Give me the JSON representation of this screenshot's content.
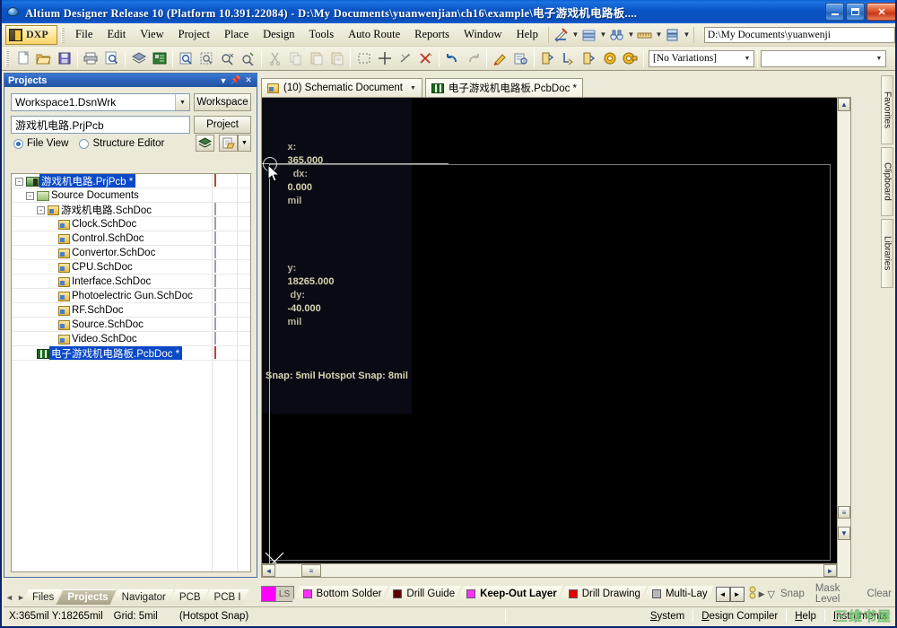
{
  "window": {
    "title": "Altium Designer Release 10 (Platform 10.391.22084) - D:\\My Documents\\yuanwenjian\\ch16\\example\\电子游戏机电路板....",
    "app_icon": "altium-sphere-icon",
    "minimize": "minimize-icon",
    "maximize": "maximize-icon",
    "close": "close-icon"
  },
  "menubar": {
    "dxp_label": "DXP",
    "items": [
      "File",
      "Edit",
      "View",
      "Project",
      "Place",
      "Design",
      "Tools",
      "Auto Route",
      "Reports",
      "Window",
      "Help"
    ],
    "tools": [
      "ruler-pencil-icon",
      "layers-stack-icon",
      "binoculars-icon",
      "ruler-bar-icon",
      "stack-sheets-icon"
    ],
    "path_value": "D:\\My Documents\\yuanwenji"
  },
  "toolbar": {
    "icons": [
      "new-document-icon",
      "open-folder-icon",
      "save-icon",
      "print-icon",
      "print-preview-icon",
      "board-layers-icon",
      "pcb-board-icon",
      "zoom-document-icon",
      "zoom-area-icon",
      "zoom-out-icon",
      "zoom-selected-icon",
      "cut-icon",
      "copy-icon",
      "paste-icon",
      "paste-special-icon",
      "select-area-icon",
      "move-icon",
      "deselect-icon",
      "clear-selection-icon",
      "undo-icon",
      "redo-icon",
      "highlight-icon",
      "cross-probe-icon",
      "place-component-icon",
      "place-net-icon",
      "place-polygon-icon",
      "place-via-icon",
      "place-pad-icon"
    ],
    "variation_value": "[No Variations]",
    "variation_caret": "chevron-down-icon",
    "extra_value": ""
  },
  "projects_panel": {
    "title": "Projects",
    "header_icons": [
      "chevron-down-icon",
      "pin-icon",
      "close-icon"
    ],
    "workspace_value": "Workspace1.DsnWrk",
    "workspace_button": "Workspace",
    "project_value": "游戏机电路.PrjPcb",
    "project_button": "Project",
    "view_modes": [
      {
        "label": "File View",
        "selected": true
      },
      {
        "label": "Structure Editor",
        "selected": false
      }
    ],
    "action_icons": [
      "layers-icon",
      "open-document-icon",
      "chevron-down-icon"
    ],
    "tree": [
      {
        "label": "游戏机电路.PrjPcb *",
        "indent": 0,
        "icon": "project-icon",
        "expander": "-",
        "selected": true,
        "doc": "red-doc-icon"
      },
      {
        "label": "Source Documents",
        "indent": 1,
        "icon": "folder-icon",
        "expander": "-",
        "selected": false,
        "doc": ""
      },
      {
        "label": "游戏机电路.SchDoc",
        "indent": 2,
        "icon": "schematic-icon",
        "expander": "-",
        "selected": false,
        "doc": "doc-icon"
      },
      {
        "label": "Clock.SchDoc",
        "indent": 3,
        "icon": "schematic-icon",
        "expander": "",
        "selected": false,
        "doc": "doc-icon"
      },
      {
        "label": "Control.SchDoc",
        "indent": 3,
        "icon": "schematic-icon",
        "expander": "",
        "selected": false,
        "doc": "doc-icon"
      },
      {
        "label": "Convertor.SchDoc",
        "indent": 3,
        "icon": "schematic-icon",
        "expander": "",
        "selected": false,
        "doc": "doc-icon"
      },
      {
        "label": "CPU.SchDoc",
        "indent": 3,
        "icon": "schematic-icon",
        "expander": "",
        "selected": false,
        "doc": "doc-icon"
      },
      {
        "label": "Interface.SchDoc",
        "indent": 3,
        "icon": "schematic-icon",
        "expander": "",
        "selected": false,
        "doc": "doc-icon"
      },
      {
        "label": "Photoelectric Gun.SchDoc",
        "indent": 3,
        "icon": "schematic-icon",
        "expander": "",
        "selected": false,
        "doc": "doc-icon"
      },
      {
        "label": "RF.SchDoc",
        "indent": 3,
        "icon": "schematic-icon",
        "expander": "",
        "selected": false,
        "doc": "doc-icon"
      },
      {
        "label": "Source.SchDoc",
        "indent": 3,
        "icon": "schematic-icon",
        "expander": "",
        "selected": false,
        "doc": "doc-icon"
      },
      {
        "label": "Video.SchDoc",
        "indent": 3,
        "icon": "schematic-icon",
        "expander": "",
        "selected": false,
        "doc": "doc-icon"
      },
      {
        "label": "电子游戏机电路板.PcbDoc *",
        "indent": 1,
        "icon": "pcb-icon",
        "expander": "",
        "selected": true,
        "doc": "red-doc-icon"
      }
    ]
  },
  "left_panel_tabs": {
    "nav_prev": "prev-icon",
    "nav_next": "next-icon",
    "tabs": [
      {
        "label": "Files",
        "active": false
      },
      {
        "label": "Projects",
        "active": true
      },
      {
        "label": "Navigator",
        "active": false
      },
      {
        "label": "PCB",
        "active": false
      },
      {
        "label": "PCB I",
        "active": false
      }
    ]
  },
  "document_tabs": [
    {
      "label": "(10) Schematic Document",
      "icon": "schematic-icon",
      "active": false,
      "caret": "chevron-down-icon"
    },
    {
      "label": "电子游戏机电路板.PcbDoc *",
      "icon": "pcb-icon",
      "active": true,
      "caret": ""
    }
  ],
  "canvas": {
    "coords": {
      "x_label": "x:",
      "x_value": "365.000",
      "dx_label": "dx:",
      "dx_value": "0.000",
      "x_unit": "mil",
      "y_label": "y:",
      "y_value": "18265.000",
      "dy_label": "dy:",
      "dy_value": "-40.000",
      "y_unit": "mil",
      "snap_line": "Snap: 5mil Hotspot Snap: 8mil"
    },
    "cursor": "crosshair-cursor",
    "background_color": "#000000",
    "board_outline_color": "#7a7a7a"
  },
  "right_tabs": [
    {
      "label": "Favorites"
    },
    {
      "label": "Clipboard"
    },
    {
      "label": "Libraries"
    }
  ],
  "layer_bar": {
    "current_color": "#ff00ff",
    "ls_label": "LS",
    "layers": [
      {
        "label": "Bottom Solder",
        "color": "#ff2fff",
        "active": false
      },
      {
        "label": "Drill Guide",
        "color": "#5a0000",
        "active": false
      },
      {
        "label": "Keep-Out Layer",
        "color": "#ff2fff",
        "active": true
      },
      {
        "label": "Drill Drawing",
        "color": "#e00000",
        "active": false
      },
      {
        "label": "Multi-Lay",
        "color": "#b8b8b8",
        "active": false
      }
    ],
    "scroll_left": "left-arrow-icon",
    "scroll_right": "right-arrow-icon",
    "mask_icons": [
      "traffic-light-icon",
      "play-icon",
      "filter-icon"
    ],
    "buttons": [
      "Snap",
      "Mask Level",
      "Clear"
    ]
  },
  "statusbar": {
    "coords": "X:365mil Y:18265mil",
    "grid": "Grid: 5mil",
    "mode": "(Hotspot Snap)",
    "links": [
      "System",
      "Design Compiler",
      "Help",
      "Instruments"
    ],
    "watermark": "三维书屋"
  }
}
